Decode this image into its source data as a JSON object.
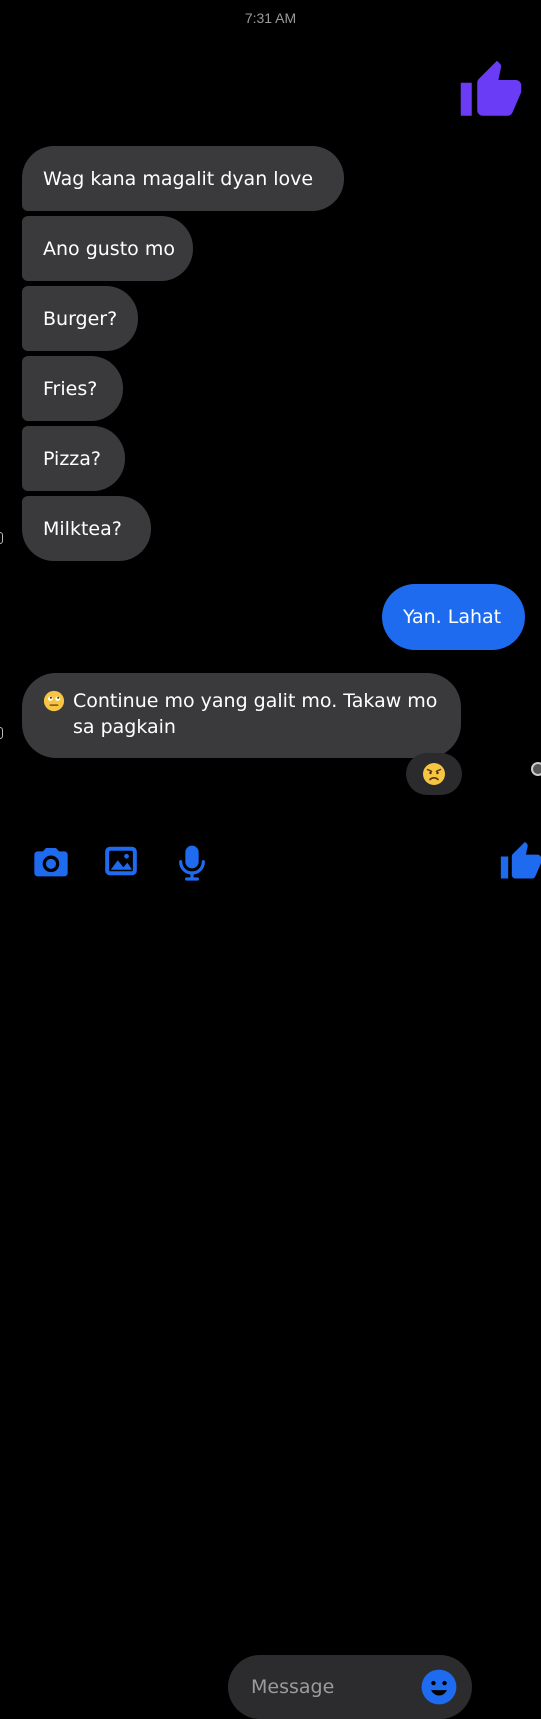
{
  "timestamp": "7:31 AM",
  "messages": {
    "received": [
      "Wag kana magalit dyan love",
      "Ano gusto mo",
      "Burger?",
      "Fries?",
      "Pizza?",
      "Milktea?"
    ],
    "sent": "Yan. Lahat",
    "reply_text": "Continue mo yang galit mo. Takaw mo sa pagkain"
  },
  "icons": {
    "sent_like": "thumbs-up-icon",
    "reply_emoji": "face-with-rolling-eyes-icon",
    "reaction": "angry-face-icon",
    "camera": "camera-icon",
    "gallery": "image-icon",
    "mic": "microphone-icon",
    "emoji": "smiley-icon",
    "like": "thumbs-up-icon"
  },
  "composer": {
    "placeholder": "Message"
  },
  "colors": {
    "background": "#000000",
    "bubble_received": "#3a3a3c",
    "bubble_sent": "#1e6bf0",
    "like_sent": "#6b3cf5",
    "accent": "#1e6bf0"
  }
}
